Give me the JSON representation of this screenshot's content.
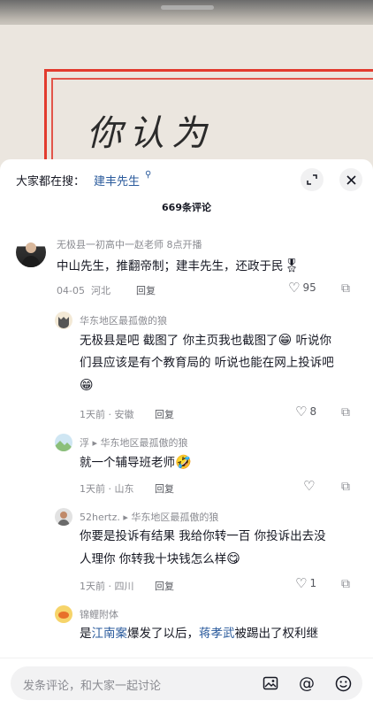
{
  "video": {
    "handwritten_text": "你认为"
  },
  "search_hint": {
    "prefix": "大家都在搜：",
    "term": "建丰先生",
    "icon": "search-icon"
  },
  "comment_count": "669条评论",
  "comments": [
    {
      "user": "无极县一初高中一赵老师 8点开播",
      "text": "中山先生，推翻帝制；建丰先生，还政于民",
      "emoji": "🎖",
      "date": "04-05",
      "location": "河北",
      "reply_label": "回复",
      "likes": "95"
    },
    {
      "user": "华东地区最孤傲的狼",
      "text_line1": "无极县是吧 截图了 你主页我也截图了",
      "text_line1_emoji": "😁",
      "text_line1_tail": " 听说你",
      "text_line2": "们县应该是有个教育局的 听说也能在网上投诉吧",
      "text_line3_emoji": "😁",
      "date": "1天前",
      "location": "安徽",
      "reply_label": "回复",
      "likes": "8"
    },
    {
      "user": "浮",
      "reply_to": "华东地区最孤傲的狼",
      "text": "就一个辅导班老师",
      "emoji": "🤣",
      "date": "1天前",
      "location": "山东",
      "reply_label": "回复",
      "likes": ""
    },
    {
      "user": "52hertz.",
      "reply_to": "华东地区最孤傲的狼",
      "text_line1": "你要是投诉有结果 我给你转一百  你投诉出去没",
      "text_line2": "人理你 你转我十块钱怎么样",
      "emoji": "😋",
      "date": "1天前",
      "location": "四川",
      "reply_label": "回复",
      "likes": "1"
    },
    {
      "user": "锦鲤附体",
      "text_part1": "是",
      "link1": "江南案",
      "text_part2": "爆发了以后，",
      "link2": "蒋孝武",
      "text_part3": "被踢出了权利继"
    }
  ],
  "bottom_bar": {
    "placeholder": "发条评论，和大家一起讨论",
    "icons": [
      "image-icon",
      "at-icon",
      "emoji-icon"
    ]
  },
  "colors": {
    "accent_link": "#2b5b9c",
    "frame_red": "#e23b2e"
  }
}
